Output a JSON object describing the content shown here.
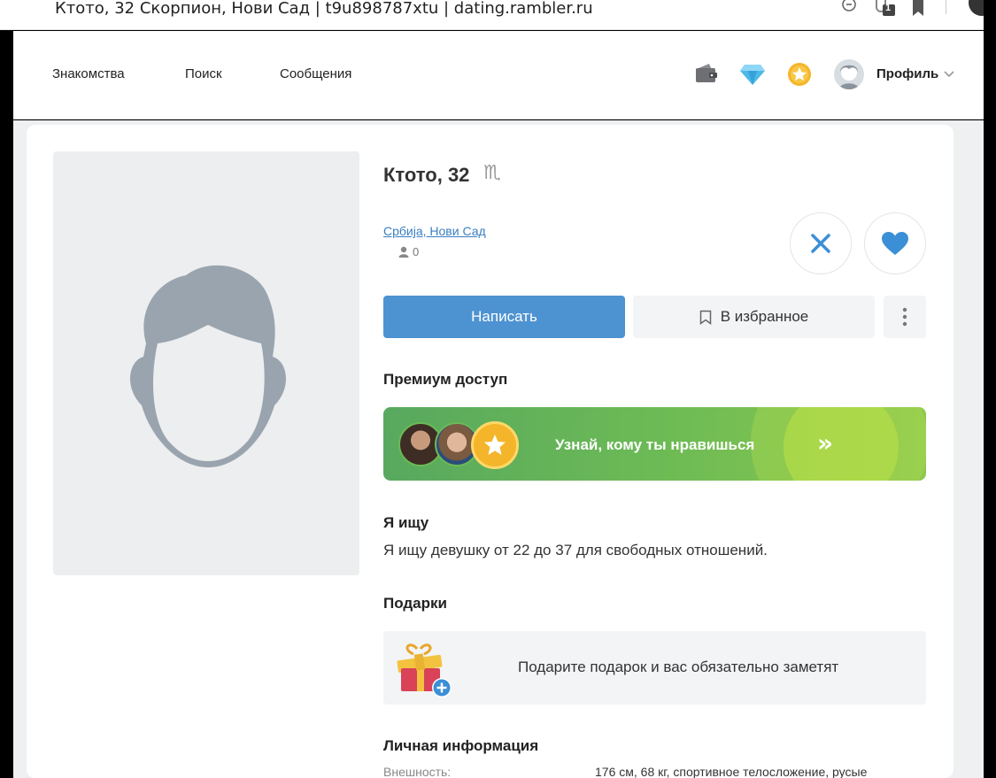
{
  "browser": {
    "title": "Ктото, 32 Скорпион, Нови Сад | t9u898787xtu | dating.rambler.ru",
    "extension_badge": "1",
    "icons": [
      "zoom-icon",
      "extension-icon",
      "bookmark-icon",
      "browser-profile-icon"
    ]
  },
  "nav": {
    "items": [
      {
        "label": "Знакомства"
      },
      {
        "label": "Поиск"
      },
      {
        "label": "Сообщения"
      }
    ],
    "icons": [
      "wallet-icon",
      "diamond-icon",
      "star-icon",
      "profile-avatar",
      "chevron-down-icon"
    ],
    "profile_label": "Профиль"
  },
  "profile": {
    "name_age": "Ктото, 32",
    "zodiac": "♏",
    "location": "Србија, Нови Сад",
    "visits": "0",
    "write_label": "Написать",
    "favorite_label": "В избранное"
  },
  "premium": {
    "title": "Премиум доступ",
    "banner_text": "Узнай, кому ты нравишься",
    "arrows": "»"
  },
  "seeking": {
    "title": "Я ищу",
    "text": "Я ищу девушку от 22 до 37 для свободных отношений."
  },
  "gifts": {
    "title": "Подарки",
    "text": "Подарите подарок и вас обязательно заметят"
  },
  "personal_info": {
    "title": "Личная информация",
    "rows": [
      {
        "label": "Внешность:",
        "value": "176 см, 68 кг, спортивное телосложение, русые"
      }
    ]
  },
  "colors": {
    "primary": "#4e93d1",
    "premium_green": "#6cba55",
    "link": "#3a7fc1",
    "avatar_placeholder": "#9aa4ae"
  }
}
